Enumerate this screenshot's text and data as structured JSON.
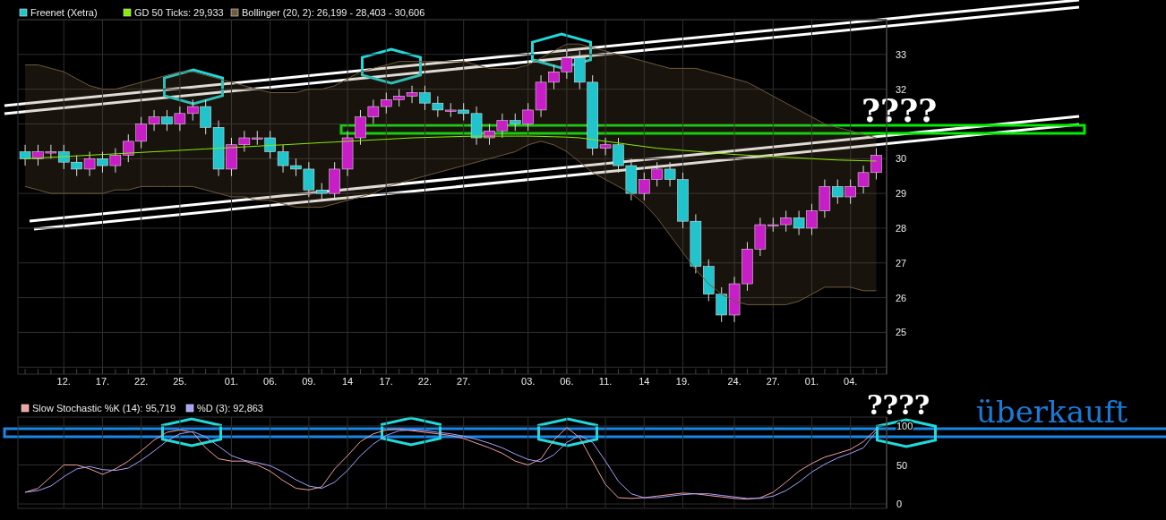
{
  "price_panel": {
    "legend": [
      {
        "label": "Freenet (Xetra)",
        "color": "#20c4cc"
      }
    ],
    "annotation": "????",
    "chart_data": {
      "type": "candlestick",
      "grid": true,
      "legend": true,
      "ylim": [
        23.8,
        34.0
      ],
      "yticks": [
        25,
        26,
        27,
        28,
        29,
        30,
        32,
        33
      ],
      "categories": [
        null,
        null,
        null,
        "12.",
        null,
        null,
        "17.",
        null,
        null,
        "22.",
        null,
        null,
        "25.",
        null,
        null,
        null,
        "01.",
        null,
        null,
        "06.",
        null,
        null,
        "09.",
        null,
        null,
        "14",
        null,
        null,
        "17.",
        null,
        null,
        "22.",
        null,
        null,
        "27.",
        null,
        null,
        null,
        null,
        "03.",
        null,
        null,
        "06.",
        null,
        null,
        "11.",
        null,
        null,
        "14",
        null,
        null,
        "19.",
        null,
        null,
        null,
        "24.",
        null,
        null,
        "27.",
        null,
        null,
        "01.",
        null,
        null,
        "04.",
        null,
        null
      ],
      "ohlc": [
        [
          30.2,
          30.4,
          29.8,
          30.0
        ],
        [
          30.0,
          30.4,
          29.8,
          30.2
        ],
        [
          30.2,
          30.4,
          30.0,
          30.2
        ],
        [
          30.2,
          30.4,
          29.7,
          29.9
        ],
        [
          29.9,
          30.1,
          29.5,
          29.7
        ],
        [
          29.7,
          30.2,
          29.5,
          30.0
        ],
        [
          30.0,
          30.2,
          29.6,
          29.8
        ],
        [
          29.8,
          30.3,
          29.6,
          30.1
        ],
        [
          30.1,
          30.7,
          29.9,
          30.5
        ],
        [
          30.5,
          31.2,
          30.3,
          31.0
        ],
        [
          31.0,
          31.4,
          30.8,
          31.2
        ],
        [
          31.2,
          31.4,
          30.8,
          31.0
        ],
        [
          31.0,
          31.5,
          30.8,
          31.3
        ],
        [
          31.3,
          31.7,
          31.1,
          31.5
        ],
        [
          31.5,
          31.7,
          30.7,
          30.9
        ],
        [
          30.9,
          31.1,
          29.5,
          29.7
        ],
        [
          29.7,
          30.6,
          29.5,
          30.4
        ],
        [
          30.4,
          30.8,
          30.2,
          30.6
        ],
        [
          30.6,
          30.8,
          30.4,
          30.6
        ],
        [
          30.6,
          30.8,
          30.0,
          30.2
        ],
        [
          30.2,
          30.4,
          29.6,
          29.8
        ],
        [
          29.8,
          30.0,
          29.5,
          29.7
        ],
        [
          29.7,
          29.9,
          28.9,
          29.1
        ],
        [
          29.1,
          29.3,
          28.8,
          29.0
        ],
        [
          29.0,
          29.9,
          28.8,
          29.7
        ],
        [
          29.7,
          30.8,
          29.5,
          30.6
        ],
        [
          30.6,
          31.4,
          30.4,
          31.2
        ],
        [
          31.2,
          31.7,
          31.0,
          31.5
        ],
        [
          31.5,
          31.9,
          31.3,
          31.7
        ],
        [
          31.7,
          32.0,
          31.5,
          31.8
        ],
        [
          31.8,
          32.1,
          31.6,
          31.9
        ],
        [
          31.9,
          32.1,
          31.4,
          31.6
        ],
        [
          31.6,
          31.8,
          31.2,
          31.4
        ],
        [
          31.4,
          31.6,
          31.2,
          31.4
        ],
        [
          31.4,
          31.6,
          31.1,
          31.3
        ],
        [
          31.3,
          31.5,
          30.4,
          30.6
        ],
        [
          30.6,
          31.0,
          30.4,
          30.8
        ],
        [
          30.8,
          31.3,
          30.6,
          31.1
        ],
        [
          31.1,
          31.3,
          30.8,
          31.0
        ],
        [
          31.0,
          31.6,
          30.8,
          31.4
        ],
        [
          31.4,
          32.4,
          31.2,
          32.2
        ],
        [
          32.2,
          32.7,
          32.0,
          32.5
        ],
        [
          32.5,
          33.1,
          32.3,
          32.9
        ],
        [
          32.9,
          33.1,
          32.0,
          32.2
        ],
        [
          32.2,
          32.4,
          30.1,
          30.3
        ],
        [
          30.3,
          30.6,
          30.1,
          30.4
        ],
        [
          30.4,
          30.6,
          29.6,
          29.8
        ],
        [
          29.8,
          30.0,
          28.8,
          29.0
        ],
        [
          29.0,
          29.6,
          28.8,
          29.4
        ],
        [
          29.4,
          29.9,
          29.2,
          29.7
        ],
        [
          29.7,
          29.9,
          29.2,
          29.4
        ],
        [
          29.4,
          29.6,
          28.0,
          28.2
        ],
        [
          28.2,
          28.4,
          26.7,
          26.9
        ],
        [
          26.9,
          27.1,
          25.9,
          26.1
        ],
        [
          26.1,
          26.3,
          25.3,
          25.5
        ],
        [
          25.5,
          26.6,
          25.3,
          26.4
        ],
        [
          26.4,
          27.6,
          26.2,
          27.4
        ],
        [
          27.4,
          28.3,
          27.2,
          28.1
        ],
        [
          28.1,
          28.3,
          27.9,
          28.1
        ],
        [
          28.1,
          28.5,
          27.9,
          28.3
        ],
        [
          28.3,
          28.5,
          27.8,
          28.0
        ],
        [
          28.0,
          28.7,
          27.8,
          28.5
        ],
        [
          28.5,
          29.4,
          28.3,
          29.2
        ],
        [
          29.2,
          29.4,
          28.7,
          28.9
        ],
        [
          28.9,
          29.4,
          28.7,
          29.2
        ],
        [
          29.2,
          29.8,
          29.0,
          29.6
        ],
        [
          29.6,
          30.3,
          29.4,
          30.1
        ]
      ],
      "series": [
        {
          "name": "GD 50 Ticks: 29,933",
          "color": "#88ee00",
          "type": "line",
          "values": [
            30.0,
            30.02,
            30.04,
            30.06,
            30.08,
            30.1,
            30.12,
            30.14,
            30.16,
            30.18,
            30.2,
            30.22,
            30.24,
            30.26,
            30.28,
            30.3,
            30.32,
            30.34,
            30.36,
            30.38,
            30.4,
            30.42,
            30.44,
            30.46,
            30.48,
            30.5,
            30.52,
            30.54,
            30.56,
            30.58,
            30.6,
            30.61,
            30.62,
            30.63,
            30.64,
            30.65,
            30.65,
            30.65,
            30.65,
            30.65,
            30.64,
            30.63,
            30.62,
            30.6,
            30.55,
            30.5,
            30.45,
            30.4,
            30.35,
            30.3,
            30.27,
            30.24,
            30.21,
            30.18,
            30.15,
            30.12,
            30.1,
            30.08,
            30.06,
            30.04,
            30.02,
            30.0,
            29.98,
            29.96,
            29.95,
            29.94,
            29.93
          ]
        },
        {
          "name": "Bollinger (20, 2): 26,199 - 28,403 - 30,606",
          "color": "#6e5a3c",
          "type": "area",
          "values": [
            32.7,
            32.7,
            32.6,
            32.5,
            32.3,
            32.1,
            32.0,
            32.0,
            32.1,
            32.2,
            32.3,
            32.4,
            32.5,
            32.5,
            32.4,
            32.3,
            32.2,
            32.1,
            32.0,
            31.9,
            31.9,
            31.9,
            32.0,
            32.0,
            32.1,
            32.3,
            32.5,
            32.6,
            32.7,
            32.8,
            32.8,
            32.8,
            32.8,
            32.8,
            32.8,
            32.7,
            32.6,
            32.6,
            32.6,
            32.7,
            32.9,
            33.1,
            33.3,
            33.3,
            33.2,
            33.1,
            33.0,
            32.9,
            32.8,
            32.7,
            32.6,
            32.6,
            32.6,
            32.5,
            32.4,
            32.3,
            32.2,
            32.0,
            31.8,
            31.6,
            31.4,
            31.2,
            31.0,
            30.9,
            30.8,
            30.7,
            30.6
          ]
        },
        {
          "color": "#6e5a3c",
          "type": "line",
          "values": [
            29.2,
            29.1,
            29.0,
            29.0,
            29.0,
            29.0,
            29.0,
            29.1,
            29.1,
            29.2,
            29.2,
            29.2,
            29.2,
            29.2,
            29.1,
            29.0,
            28.9,
            28.9,
            28.8,
            28.8,
            28.7,
            28.6,
            28.6,
            28.6,
            28.7,
            28.8,
            28.9,
            29.0,
            29.2,
            29.3,
            29.4,
            29.5,
            29.6,
            29.7,
            29.8,
            29.9,
            30.0,
            30.1,
            30.2,
            30.4,
            30.5,
            30.4,
            30.2,
            29.9,
            29.6,
            29.4,
            29.2,
            29.0,
            28.7,
            28.3,
            27.8,
            27.3,
            26.8,
            26.4,
            26.1,
            25.9,
            25.8,
            25.8,
            25.8,
            25.8,
            25.9,
            26.1,
            26.3,
            26.3,
            26.3,
            26.2,
            26.2
          ]
        }
      ]
    }
  },
  "stochastic_panel": {
    "annotation": "????",
    "label": "überkauft",
    "chart_data": {
      "type": "line",
      "grid": true,
      "legend": true,
      "ylim": [
        -5.7,
        111.5
      ],
      "yticks": [
        0,
        50,
        100
      ],
      "series": [
        {
          "name": "Slow Stochastic %K (14): 95,719",
          "color": "#f4a0a0",
          "values": [
            15,
            20,
            35,
            50,
            50,
            45,
            38,
            45,
            55,
            68,
            82,
            92,
            95,
            92,
            72,
            58,
            55,
            55,
            50,
            42,
            30,
            20,
            18,
            22,
            45,
            62,
            80,
            90,
            95,
            96,
            94,
            92,
            90,
            88,
            84,
            78,
            72,
            65,
            55,
            50,
            58,
            82,
            98,
            85,
            55,
            25,
            8,
            7,
            8,
            10,
            12,
            14,
            13,
            11,
            9,
            7,
            6,
            8,
            15,
            28,
            42,
            52,
            60,
            65,
            70,
            80,
            96
          ]
        },
        {
          "name": "%D (3): 92,863",
          "color": "#a4a4ff",
          "values": [
            15,
            17,
            23,
            35,
            45,
            48,
            44,
            43,
            46,
            56,
            68,
            81,
            90,
            93,
            86,
            74,
            62,
            56,
            53,
            49,
            41,
            31,
            23,
            20,
            28,
            43,
            62,
            77,
            88,
            94,
            95,
            94,
            92,
            90,
            87,
            83,
            78,
            72,
            64,
            57,
            54,
            63,
            79,
            88,
            79,
            55,
            29,
            13,
            8,
            8,
            10,
            12,
            13,
            13,
            11,
            9,
            7,
            7,
            10,
            17,
            28,
            41,
            51,
            59,
            65,
            72,
            93
          ]
        }
      ]
    }
  }
}
